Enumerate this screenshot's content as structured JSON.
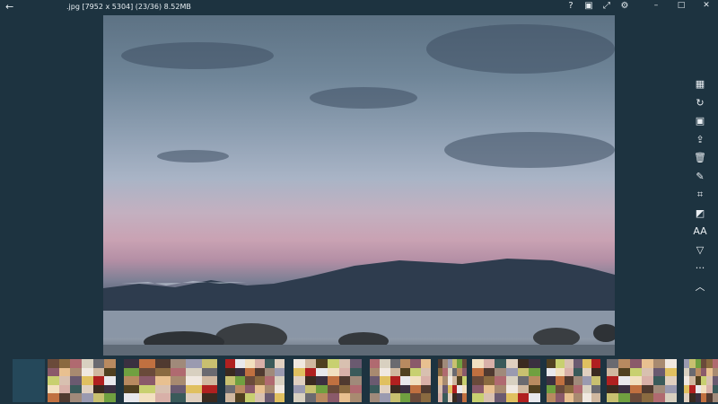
{
  "titlebar": {
    "back_icon": "arrow-left-icon",
    "file_info": ".jpg  [7952 x 5304]  (23/36)  8.52MB",
    "icons": [
      "help-icon",
      "fullscreen-icon",
      "expand-icon",
      "settings-icon"
    ],
    "help_label": "?"
  },
  "window": {
    "minimize": "–",
    "maximize": "□",
    "close": "✕"
  },
  "photo": {
    "description_icon": "landscape-photo"
  },
  "toolbar": {
    "items": [
      {
        "icon": "grid-icon",
        "glyph": "▦"
      },
      {
        "icon": "rotate-icon",
        "glyph": "↻"
      },
      {
        "icon": "slideshow-icon",
        "glyph": "▣"
      },
      {
        "icon": "share-icon",
        "glyph": "⇪"
      },
      {
        "icon": "delete-icon",
        "glyph": "🗑"
      },
      {
        "icon": "edit-icon",
        "glyph": "✎"
      },
      {
        "icon": "crop-icon",
        "glyph": "⌗"
      },
      {
        "icon": "adjust-icon",
        "glyph": "◩"
      },
      {
        "icon": "text-icon",
        "glyph": "AA"
      },
      {
        "icon": "filter-icon",
        "glyph": "▽"
      },
      {
        "icon": "more-icon",
        "glyph": "···"
      },
      {
        "icon": "collapse-icon",
        "glyph": "︿"
      }
    ]
  },
  "filmstrip": {
    "colors": [
      "#6a4a3a",
      "#d8c0b0",
      "#a08a7a",
      "#f0e8e0",
      "#3a2a20",
      "#b88a60",
      "#f2e0c0",
      "#8a6a40",
      "#6a5a70",
      "#9a9ab0",
      "#d0b8a0",
      "#3a3040",
      "#8a5a6a",
      "#d8b0a8",
      "#b06a70",
      "#e0c060",
      "#c8c070",
      "#504020",
      "#c07040",
      "#e8c090",
      "#3a5a5a",
      "#d8d0c0",
      "#b02020",
      "#70a040",
      "#c8d070",
      "#503a30",
      "#a88a70",
      "#e0d0c0",
      "#6a6a70",
      "#e8e8ec"
    ]
  }
}
